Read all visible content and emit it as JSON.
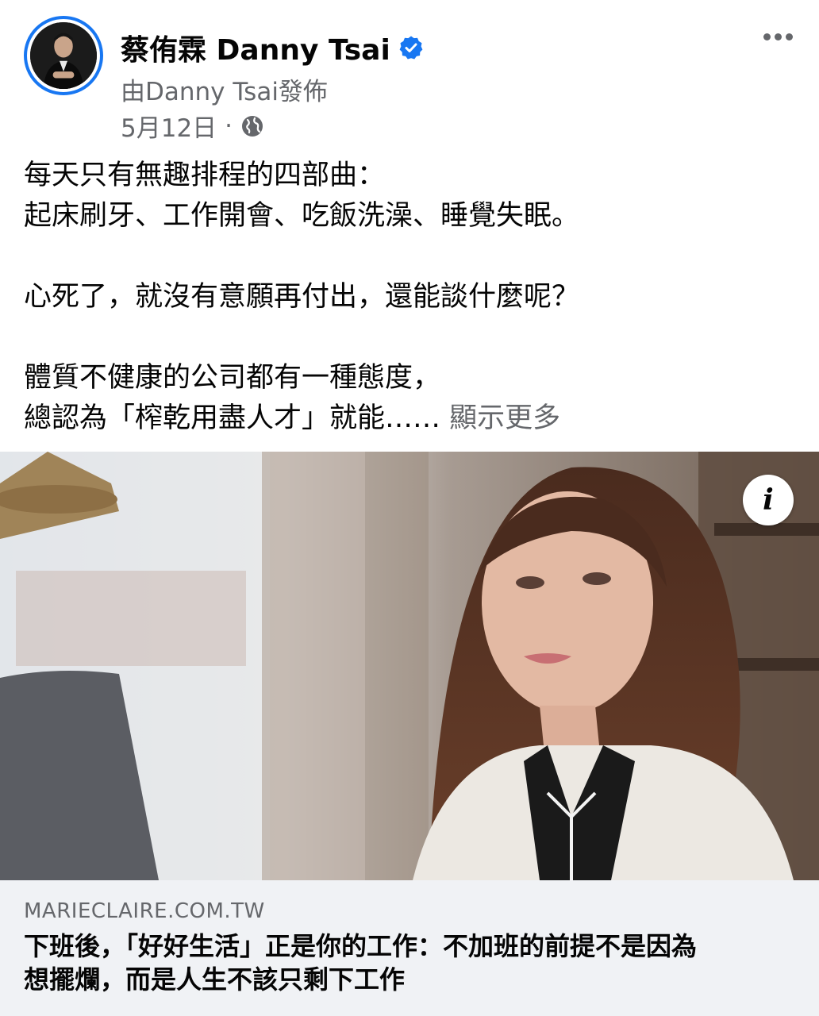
{
  "post": {
    "author": "蔡侑霖 Danny Tsai",
    "byline": "由Danny Tsai發佈",
    "date": "5月12日",
    "separator": "·"
  },
  "icons": {
    "verified": "verified-badge-icon",
    "audience": "globe-icon",
    "more": "more-options-icon",
    "info": "info-icon"
  },
  "text": {
    "line1": "每天只有無趣排程的四部曲：",
    "line2": "起床刷牙、工作開會、吃飯洗澡、睡覺失眠。",
    "line3": "心死了，就沒有意願再付出，還能談什麼呢？",
    "line4": "體質不健康的公司都有一種態度，",
    "line5": "總認為「榨乾用盡人才」就能……",
    "see_more": "顯示更多"
  },
  "link": {
    "domain": "MARIECLAIRE.COM.TW",
    "title_line1": "下班後，「好好生活」正是你的工作：不加班的前提不是因為",
    "title_line2": "想擺爛，而是人生不該只剩下工作"
  },
  "colors": {
    "accent": "#1877f2",
    "secondary_text": "#65676b",
    "card_bg": "#f0f2f5"
  }
}
